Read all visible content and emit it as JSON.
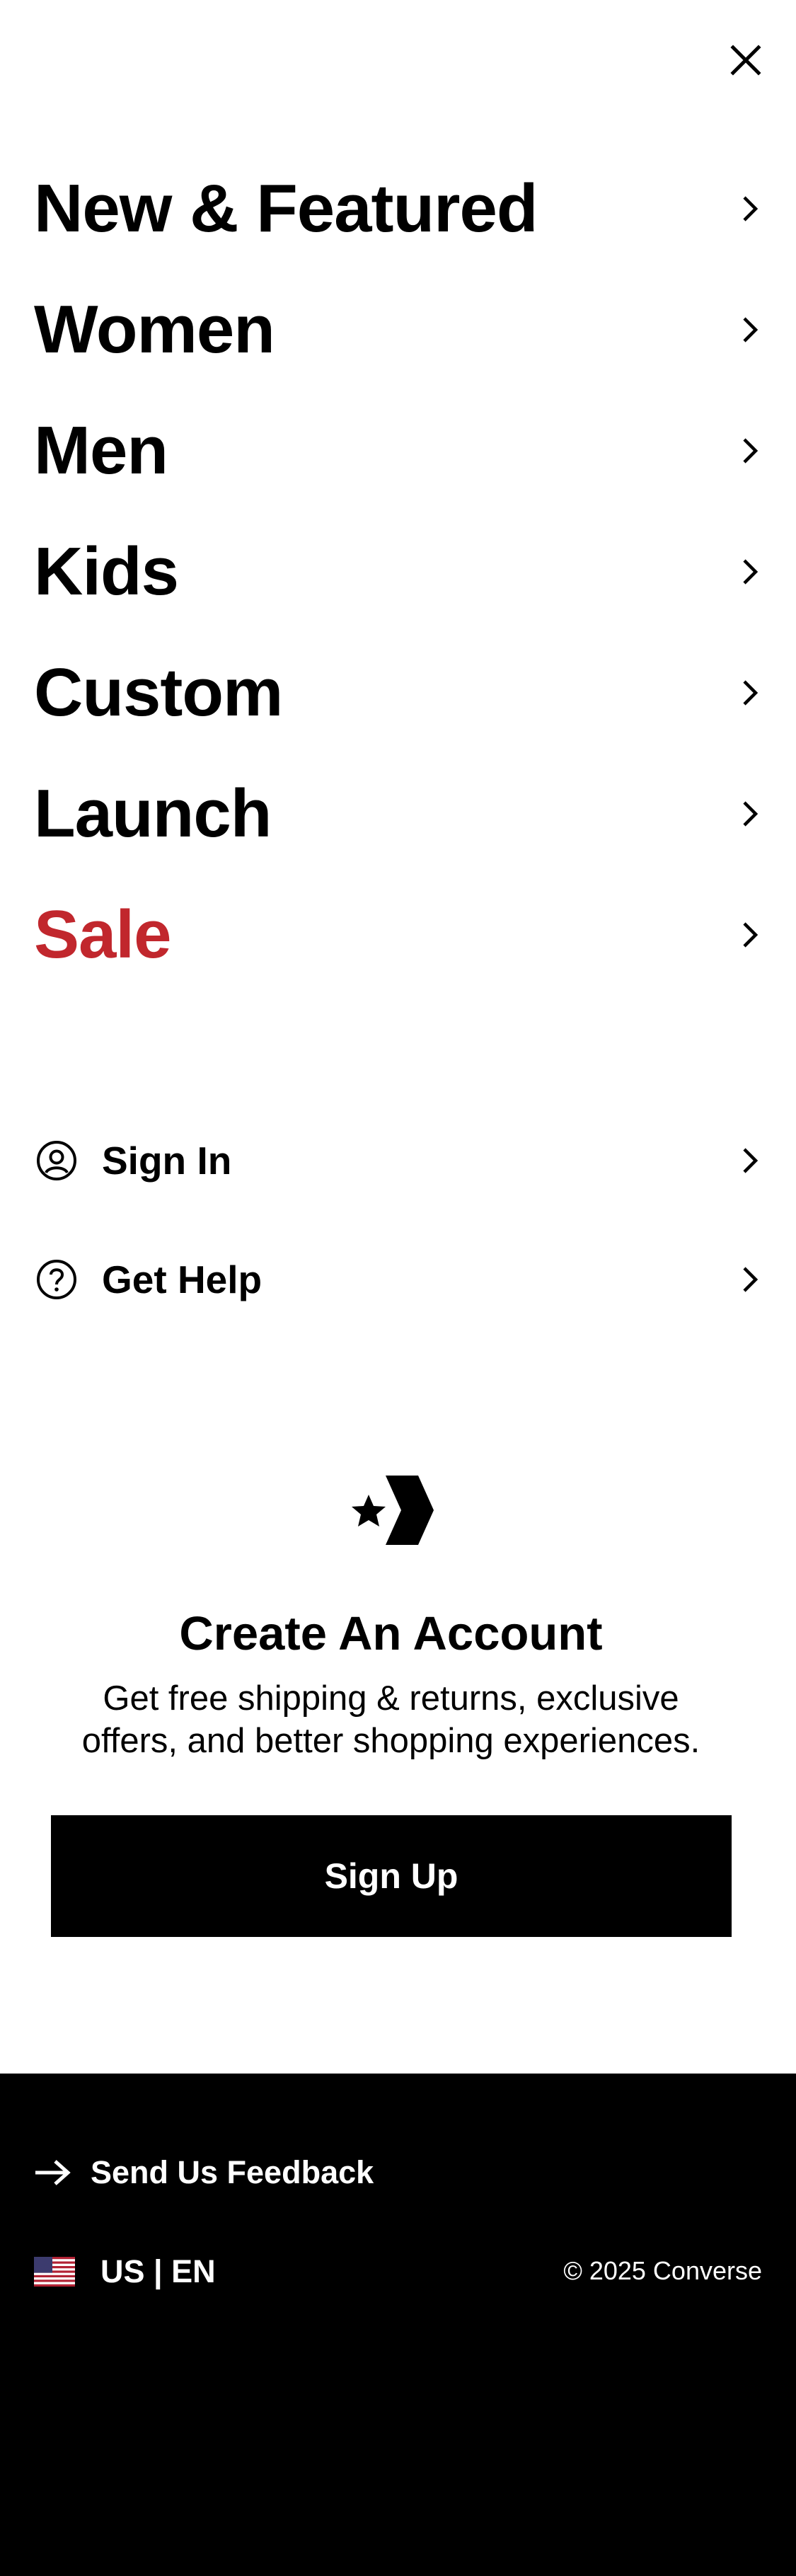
{
  "menu": {
    "close_icon": "close-icon",
    "items": [
      {
        "label": "New & Featured",
        "color": "#000000"
      },
      {
        "label": "Women",
        "color": "#000000"
      },
      {
        "label": "Men",
        "color": "#000000"
      },
      {
        "label": "Kids",
        "color": "#000000"
      },
      {
        "label": "Custom",
        "color": "#000000"
      },
      {
        "label": "Launch",
        "color": "#000000"
      },
      {
        "label": "Sale",
        "color": "#C1272D"
      }
    ]
  },
  "account_links": {
    "sign_in": {
      "label": "Sign In",
      "icon": "user-circle-icon"
    },
    "get_help": {
      "label": "Get Help",
      "icon": "help-circle-icon"
    }
  },
  "promo": {
    "logo": "converse-star-chevron-logo",
    "title": "Create An Account",
    "line1": "Get free shipping & returns, exclusive",
    "line2": "offers, and better shopping experiences.",
    "button_label": "Sign Up"
  },
  "footer": {
    "feedback_label": "Send Us Feedback",
    "locale_label": "US | EN",
    "locale_flag": "us-flag-icon",
    "copyright": "© 2025 Converse"
  }
}
